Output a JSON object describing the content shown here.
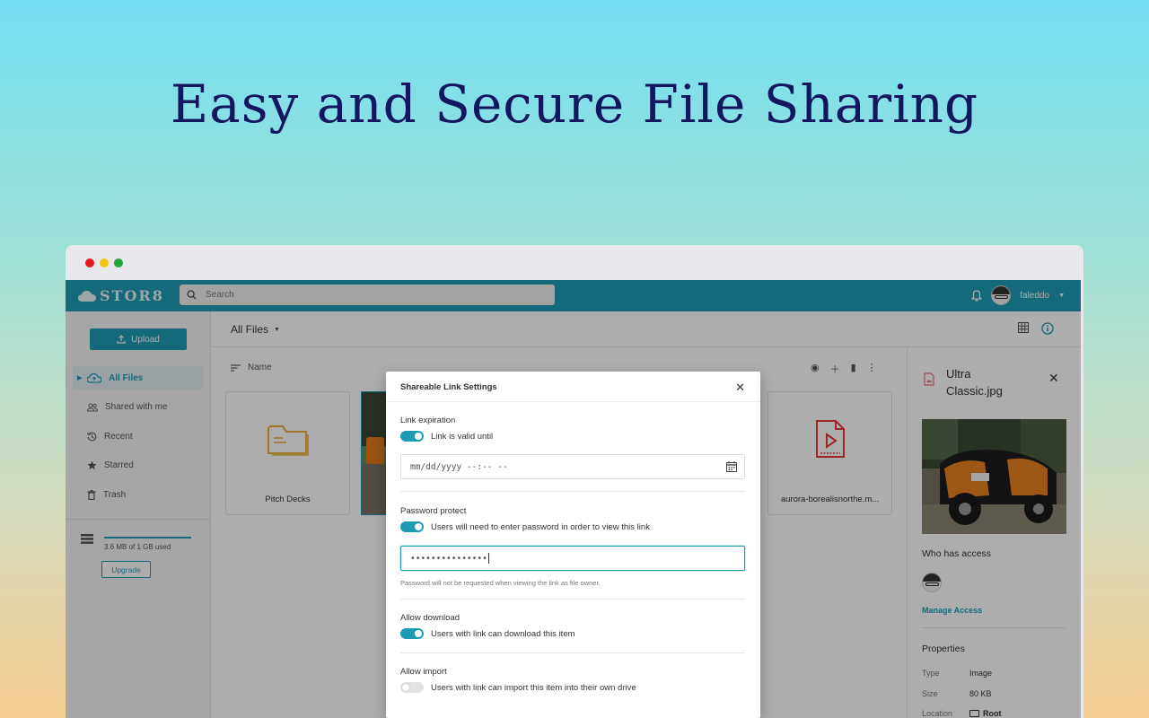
{
  "hero": {
    "title": "Easy and Secure File Sharing"
  },
  "topbar": {
    "logo": "STOR8",
    "search_placeholder": "Search",
    "username": "faleddo"
  },
  "sidebar": {
    "upload_label": "Upload",
    "items": [
      {
        "label": "All Files",
        "icon": "cloud-upload-icon",
        "active": true
      },
      {
        "label": "Shared with me",
        "icon": "people-icon",
        "active": false
      },
      {
        "label": "Recent",
        "icon": "history-icon",
        "active": false
      },
      {
        "label": "Starred",
        "icon": "star-icon",
        "active": false
      },
      {
        "label": "Trash",
        "icon": "trash-icon",
        "active": false
      }
    ],
    "storage_text": "3.6 MB of 1 GB used",
    "upgrade_label": "Upgrade"
  },
  "main": {
    "breadcrumb": "All Files",
    "sort_label": "Name",
    "cards": [
      {
        "label": "Pitch Decks",
        "icon": "folder-icon"
      },
      {
        "label": "aurora-borealisnorthe.m...",
        "icon": "video-file-icon"
      }
    ]
  },
  "details": {
    "title": "Ultra Classic.jpg",
    "who_has_access": "Who has access",
    "manage_access": "Manage Access",
    "properties_title": "Properties",
    "properties": [
      {
        "key": "Type",
        "value": "Image"
      },
      {
        "key": "Size",
        "value": "80 KB"
      },
      {
        "key": "Location",
        "value": "Root"
      }
    ]
  },
  "modal": {
    "title": "Shareable Link Settings",
    "expiration": {
      "title": "Link expiration",
      "toggle_label": "Link is valid until",
      "toggle_on": true,
      "date_placeholder": "mm/dd/yyyy --:-- --"
    },
    "password": {
      "title": "Password protect",
      "toggle_label": "Users will need to enter password in order to view this link",
      "toggle_on": true,
      "value": "•••••••••••••••",
      "hint": "Password will not be requested when viewing the link as file owner."
    },
    "download": {
      "title": "Allow download",
      "toggle_label": "Users with link can download this item",
      "toggle_on": true
    },
    "import": {
      "title": "Allow import",
      "toggle_label": "Users with link can import this item into their own drive",
      "toggle_on": false
    }
  },
  "colors": {
    "accent": "#1e9bb4",
    "hero_text": "#12175e"
  }
}
